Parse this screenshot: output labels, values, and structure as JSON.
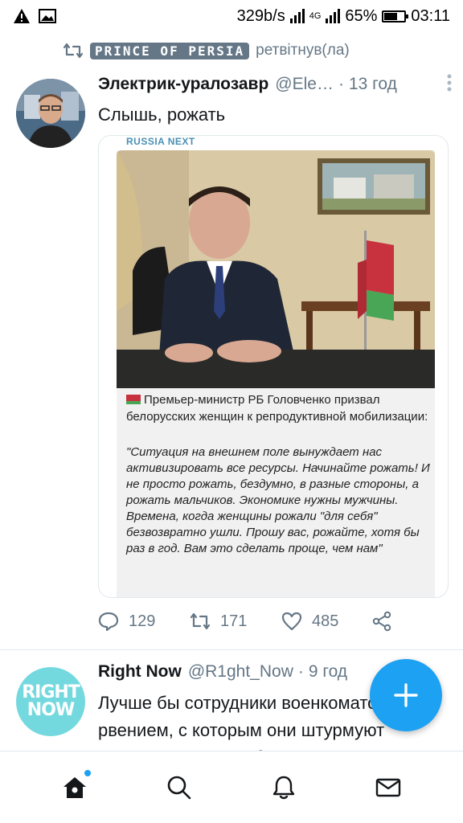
{
  "status_bar": {
    "speed": "329b/s",
    "network": "4G",
    "battery": "65%",
    "battery_level": 0.65,
    "time": "03:11"
  },
  "retweet": {
    "user": "PRINCE OF PERSIA",
    "label": "ретвітнув(ла)"
  },
  "tweet1": {
    "name": "Электрик-уралозавр",
    "handle": "@Ele…",
    "time": "13 год",
    "text": "Слышь, рожать",
    "media": {
      "source": "RUSSIA NEXT",
      "caption_head": "Премьер-министр РБ Головченко призвал белорусских женщин к репродуктивной мобилизации:",
      "caption_quote": "\"Ситуация на внешнем поле вынуждает нас активизировать все ресурсы. Начинайте рожать! И не просто рожать, бездумно, в разные стороны, а рожать мальчиков. Экономике нужны мужчины. Времена, когда женщины рожали \"для себя\" безвозвратно ушли. Прошу вас, рожайте, хотя бы раз в год. Вам это сделать проще, чем нам\""
    },
    "replies": "129",
    "retweets": "171",
    "likes": "485"
  },
  "tweet2": {
    "name": "Right Now",
    "handle": "@R1ght_Now",
    "time": "9 год",
    "avatar_text_1": "RIGHT",
    "avatar_text_2": "NOW",
    "text": "Лучше бы сотрудники военкоматов с тем рвением, с которым они штурмуют подъезды, ловили бы"
  },
  "colors": {
    "accent": "#1da1f2",
    "muted": "#657786",
    "divider": "#e1e8ed"
  },
  "icons": {
    "bottom_nav": [
      "home-icon",
      "search-icon",
      "notifications-icon",
      "messages-icon"
    ],
    "actions": [
      "reply-icon",
      "retweet-icon",
      "like-icon",
      "share-icon"
    ]
  }
}
